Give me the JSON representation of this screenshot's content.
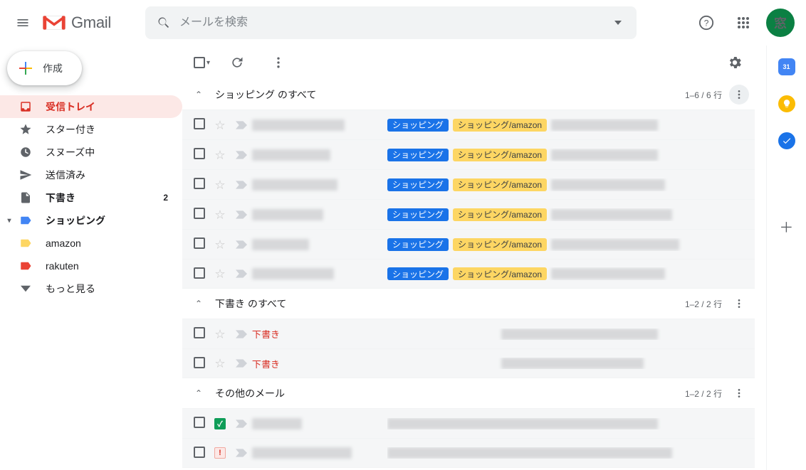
{
  "brand": {
    "name": "Gmail"
  },
  "search": {
    "placeholder": "メールを検索"
  },
  "compose": {
    "label": "作成"
  },
  "nav": {
    "inbox": "受信トレイ",
    "starred": "スター付き",
    "snoozed": "スヌーズ中",
    "sent": "送信済み",
    "drafts": "下書き",
    "drafts_count": "2",
    "shopping": "ショッピング",
    "amazon": "amazon",
    "rakuten": "rakuten",
    "more": "もっと見る"
  },
  "sections": {
    "shopping": {
      "title": "ショッピング のすべて",
      "range": "1–6 / 6 行"
    },
    "drafts": {
      "title": "下書き のすべて",
      "range": "1–2 / 2 行"
    },
    "other": {
      "title": "その他のメール",
      "range": "1–2 / 2 行"
    }
  },
  "chips": {
    "shopping": "ショッピング",
    "amazon": "ショッピング/amazon"
  },
  "draft_label": "下書き",
  "avatar_char": "窓",
  "calendar_day": "31"
}
